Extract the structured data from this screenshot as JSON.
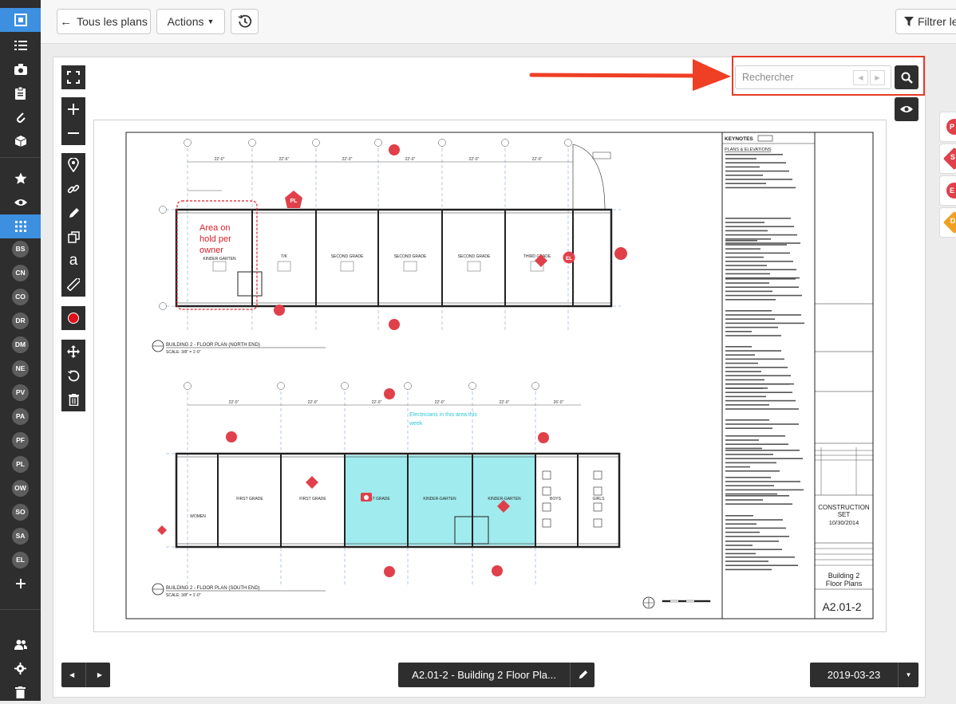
{
  "topbar": {
    "back_label": "Tous les plans",
    "actions_label": "Actions",
    "filter_label": "Filtrer le"
  },
  "sidebar": {
    "badges": [
      "BS",
      "CN",
      "CO",
      "DR",
      "DM",
      "NE",
      "PV",
      "PA",
      "PF",
      "PL",
      "OW",
      "SO",
      "SA",
      "EL"
    ]
  },
  "search": {
    "placeholder": "Rechercher"
  },
  "right_tabs": [
    {
      "label": "P",
      "color": "#e0404a"
    },
    {
      "label": "S",
      "color": "#e0404a"
    },
    {
      "label": "E",
      "color": "#e0404a"
    },
    {
      "label": "D",
      "color": "#f0a020"
    }
  ],
  "footer": {
    "sheet_label": "A2.01-2 - Building 2 Floor Pla...",
    "date_label": "2019-03-23"
  },
  "plan": {
    "sheet_number": "A2.01-2",
    "sheet_title_1": "Building 2",
    "sheet_title_2": "Floor Plans",
    "set_1": "CONSTRUCTION",
    "set_2": "SET",
    "set_date": "10/30/2014",
    "keynotes_title": "KEYNOTES",
    "keynotes_heading": "PLANS & ELEVATIONS",
    "north_title": "BUILDING 2 - FLOOR PLAN (NORTH END)",
    "south_title": "BUILDING 2 - FLOOR PLAN (SOUTH END)",
    "scale": "SCALE: 3/8\" = 1'-0\"",
    "hold_note_1": "Area on",
    "hold_note_2": "hold per",
    "hold_note_3": "owner",
    "electrician_note_1": "Electricians in this area this",
    "electrician_note_2": "week",
    "north_rooms": [
      "KINDER-GARTEN",
      "T/K",
      "SECOND GRADE",
      "SECOND GRADE",
      "SECOND GRADE",
      "THIRD GRADE"
    ],
    "south_rooms": [
      "WOMEN",
      "FIRST GRADE",
      "FIRST GRADE",
      "FIRST GRADE",
      "KINDER-GARTEN",
      "KINDER-GARTEN",
      "BOYS",
      "GIRLS"
    ],
    "markers": [
      "PL",
      "EL"
    ]
  }
}
